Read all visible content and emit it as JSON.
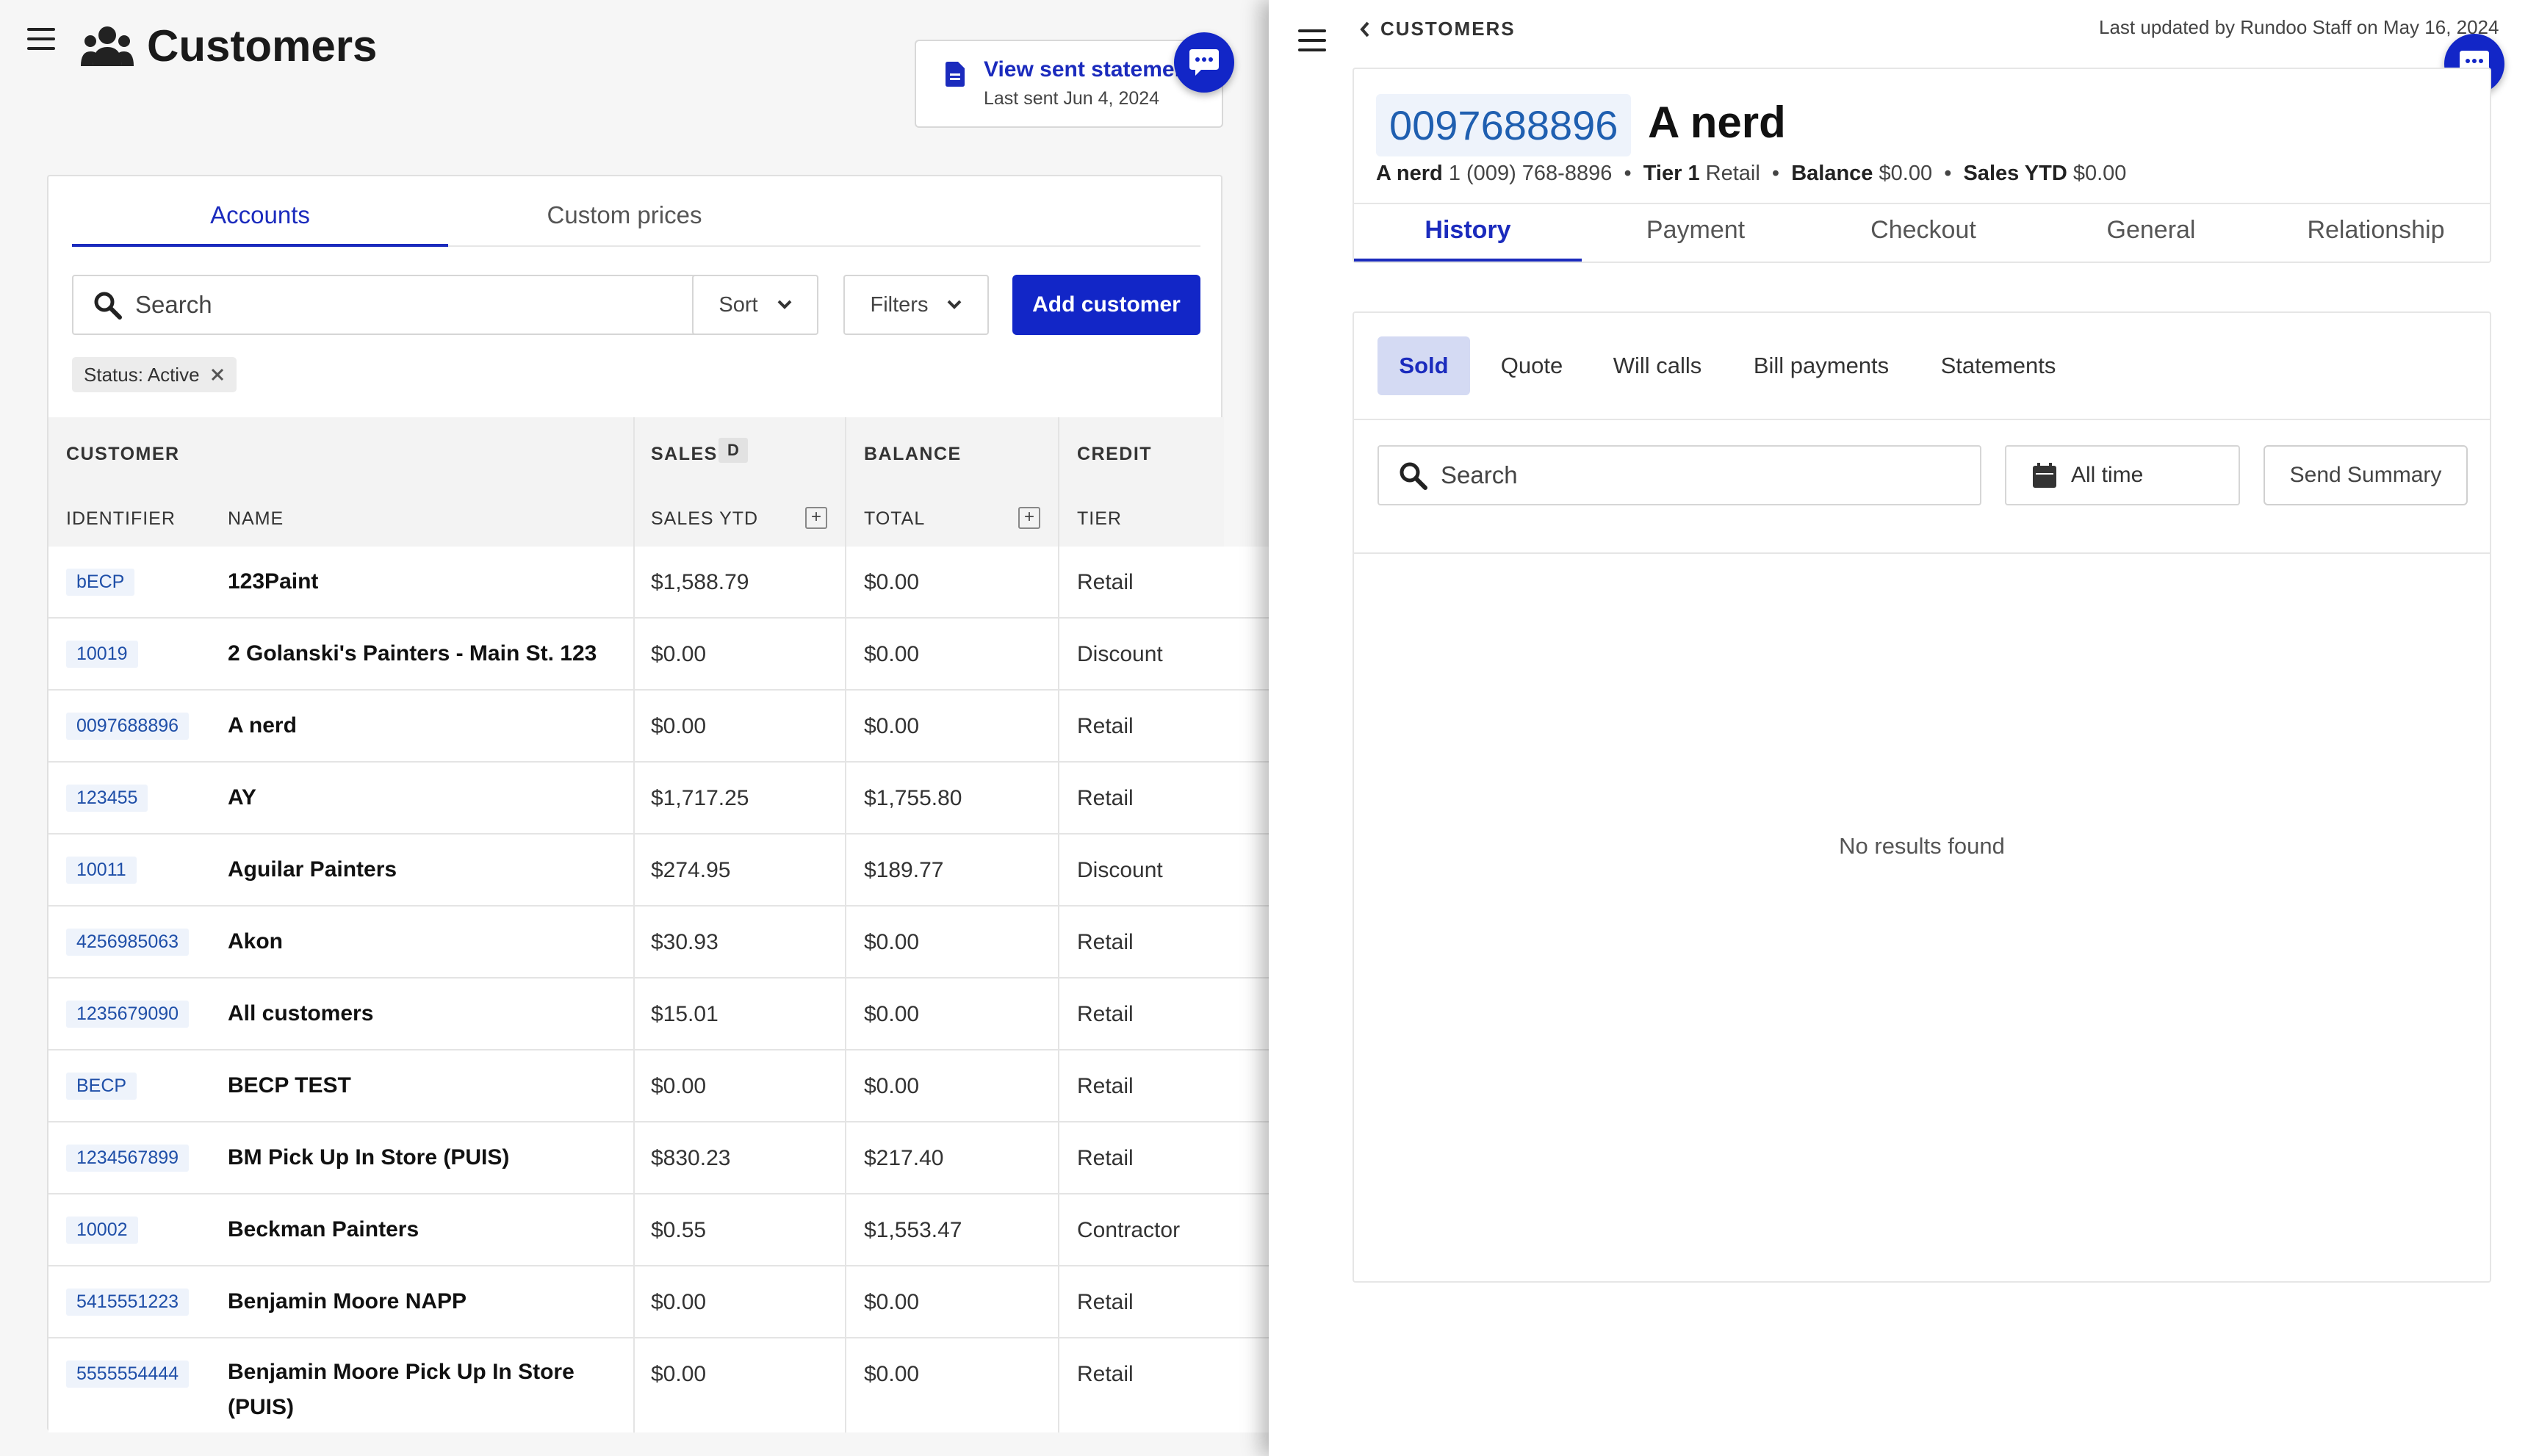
{
  "left": {
    "title": "Customers",
    "statements": {
      "link": "View sent statements",
      "sub": "Last sent Jun 4, 2024"
    },
    "tabs": [
      "Accounts",
      "Custom prices"
    ],
    "search_placeholder": "Search",
    "sort_label": "Sort",
    "filters_label": "Filters",
    "add_label": "Add customer",
    "chip_label": "Status: Active",
    "groups": {
      "customer": "CUSTOMER",
      "sales": "SALES",
      "sales_badge": "D",
      "balance": "BALANCE",
      "credit": "CREDIT"
    },
    "columns": {
      "identifier": "IDENTIFIER",
      "name": "NAME",
      "sales_ytd": "SALES YTD",
      "total": "TOTAL",
      "tier": "TIER"
    },
    "rows": [
      {
        "id": "bECP",
        "name": "123Paint",
        "sales": "$1,588.79",
        "balance": "$0.00",
        "tier": "Retail"
      },
      {
        "id": "10019",
        "name": "2 Golanski's Painters - Main St. 123",
        "sales": "$0.00",
        "balance": "$0.00",
        "tier": "Discount"
      },
      {
        "id": "0097688896",
        "name": "A nerd",
        "sales": "$0.00",
        "balance": "$0.00",
        "tier": "Retail"
      },
      {
        "id": "123455",
        "name": "AY",
        "sales": "$1,717.25",
        "balance": "$1,755.80",
        "tier": "Retail"
      },
      {
        "id": "10011",
        "name": "Aguilar Painters",
        "sales": "$274.95",
        "balance": "$189.77",
        "tier": "Discount"
      },
      {
        "id": "4256985063",
        "name": "Akon",
        "sales": "$30.93",
        "balance": "$0.00",
        "tier": "Retail"
      },
      {
        "id": "1235679090",
        "name": "All customers",
        "sales": "$15.01",
        "balance": "$0.00",
        "tier": "Retail"
      },
      {
        "id": "BECP",
        "name": "BECP TEST",
        "sales": "$0.00",
        "balance": "$0.00",
        "tier": "Retail"
      },
      {
        "id": "1234567899",
        "name": "BM Pick Up In Store (PUIS)",
        "sales": "$830.23",
        "balance": "$217.40",
        "tier": "Retail"
      },
      {
        "id": "10002",
        "name": "Beckman Painters",
        "sales": "$0.55",
        "balance": "$1,553.47",
        "tier": "Contractor"
      },
      {
        "id": "5415551223",
        "name": "Benjamin Moore NAPP",
        "sales": "$0.00",
        "balance": "$0.00",
        "tier": "Retail"
      },
      {
        "id": "5555554444",
        "name": "Benjamin Moore Pick Up In Store (PUIS)",
        "sales": "$0.00",
        "balance": "$0.00",
        "tier": "Retail"
      }
    ]
  },
  "right": {
    "breadcrumb": "CUSTOMERS",
    "updated": "Last updated by Rundoo Staff on May 16, 2024",
    "customer_id": "0097688896",
    "customer_name": "A nerd",
    "meta": {
      "name": "A nerd",
      "phone": "1 (009) 768-8896",
      "tier_label": "Tier 1",
      "tier_value": "Retail",
      "balance_label": "Balance",
      "balance_value": "$0.00",
      "sales_label": "Sales YTD",
      "sales_value": "$0.00"
    },
    "tabs": [
      "History",
      "Payment",
      "Checkout",
      "General",
      "Relationship"
    ],
    "subtabs": [
      "Sold",
      "Quote",
      "Will calls",
      "Bill payments",
      "Statements"
    ],
    "search_placeholder": "Search",
    "date_label": "All time",
    "send_summary": "Send Summary",
    "empty": "No results found"
  },
  "colors": {
    "accent": "#1226c7",
    "id_chip_bg": "#eef3fb",
    "id_chip_text": "#1f4fa8"
  }
}
